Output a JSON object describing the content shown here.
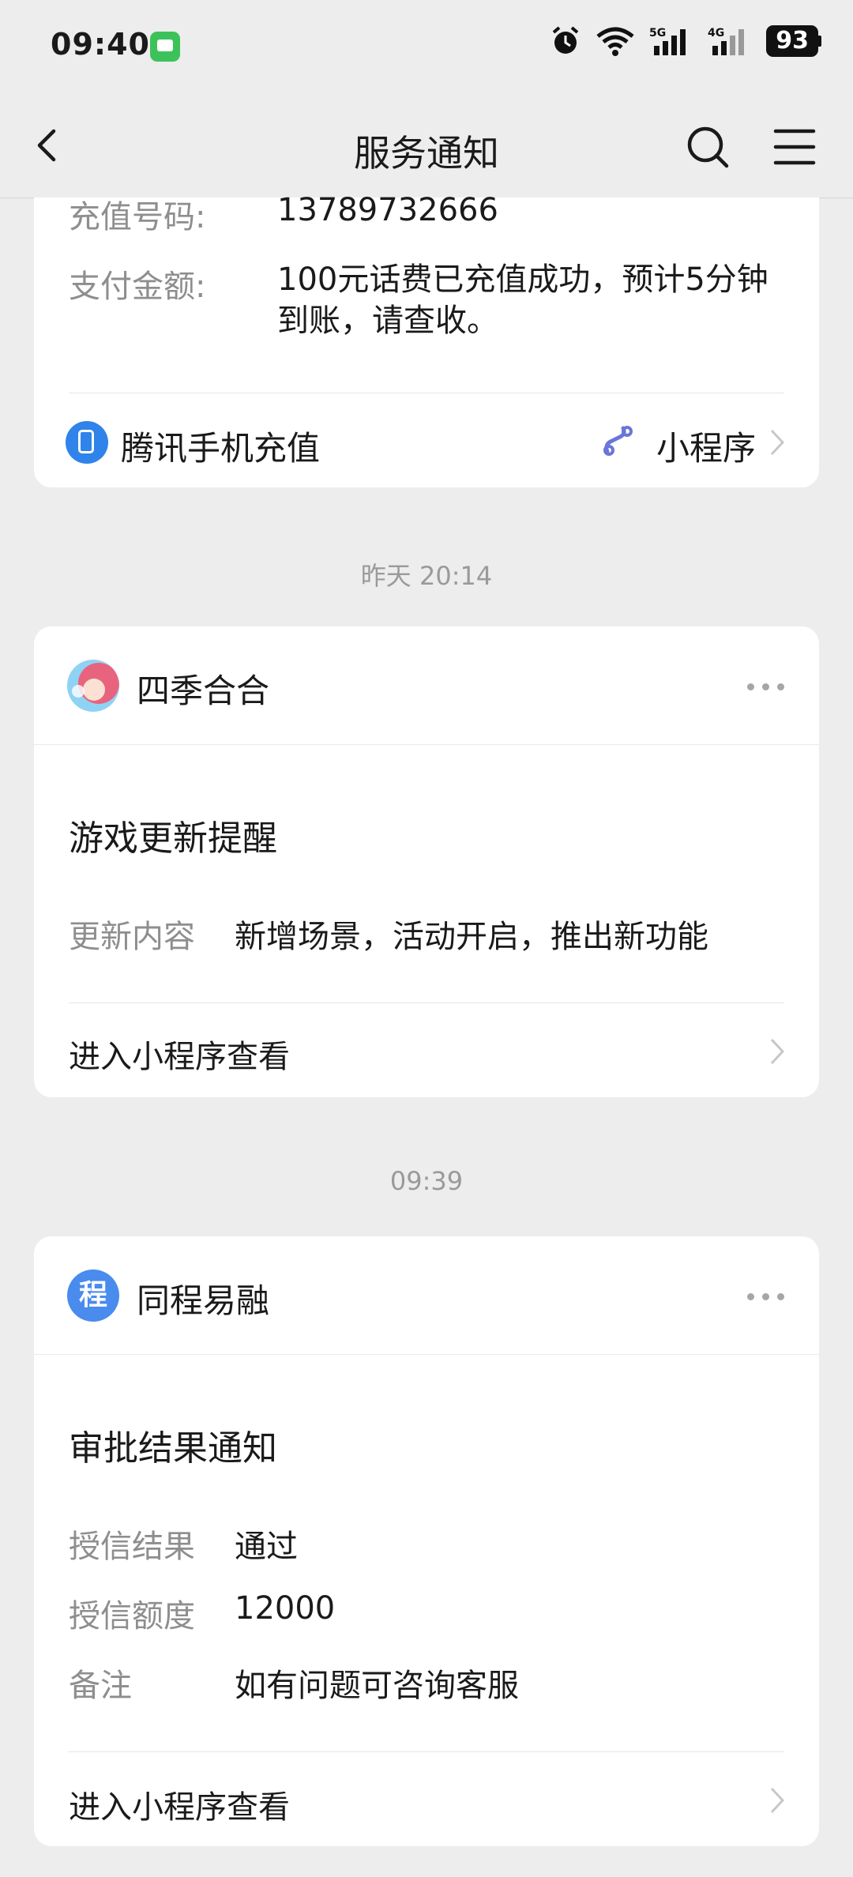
{
  "status_bar": {
    "time": "09:40",
    "battery": "93"
  },
  "nav": {
    "title": "服务通知"
  },
  "card_recharge": {
    "phone_label": "充值号码:",
    "phone_value": "13789732666",
    "amount_label": "支付金额:",
    "amount_line1": "100元话费已充值成功，预计5分钟",
    "amount_line2": "到账，请查收。",
    "app_name": "腾讯手机充值",
    "tag": "小程序"
  },
  "timestamp1": "昨天 20:14",
  "card_game": {
    "name": "四季合合",
    "title": "游戏更新提醒",
    "rows": [
      {
        "label": "更新内容",
        "value": "新增场景，活动开启，推出新功能"
      }
    ],
    "enter": "进入小程序查看"
  },
  "timestamp2": "09:39",
  "card_loan": {
    "name": "同程易融",
    "avatar_char": "程",
    "title": "审批结果通知",
    "rows": [
      {
        "label": "授信结果",
        "value": "通过"
      },
      {
        "label": "授信额度",
        "value": "12000"
      },
      {
        "label": "备注",
        "value": "如有问题可咨询客服"
      }
    ],
    "enter": "进入小程序查看"
  }
}
